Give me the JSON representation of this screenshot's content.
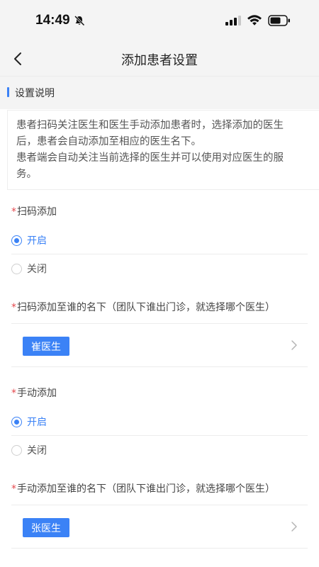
{
  "status_bar": {
    "time": "14:49"
  },
  "navbar": {
    "title": "添加患者设置"
  },
  "section": {
    "title": "设置说明"
  },
  "description": {
    "line1": "患者扫码关注医生和医生手动添加患者时，选择添加的医生",
    "line2": "后，患者会自动添加至相应的医生名下。",
    "line3": "患者端会自动关注当前选择的医生并可以使用对应医生的服",
    "line4": "务。"
  },
  "scan_add": {
    "required_mark": "*",
    "label": "扫码添加",
    "options": [
      {
        "label": "开启",
        "checked": true
      },
      {
        "label": "关闭",
        "checked": false
      }
    ]
  },
  "scan_add_target": {
    "required_mark": "*",
    "label": "扫码添加至谁的名下（团队下谁出门诊，就选择哪个医生）",
    "selected_doctor": "崔医生"
  },
  "manual_add": {
    "required_mark": "*",
    "label": "手动添加",
    "options": [
      {
        "label": "开启",
        "checked": true
      },
      {
        "label": "关闭",
        "checked": false
      }
    ]
  },
  "manual_add_target": {
    "required_mark": "*",
    "label": "手动添加至谁的名下（团队下谁出门诊，就选择哪个医生）",
    "selected_doctor": "张医生"
  },
  "colors": {
    "accent": "#3b82f6",
    "required": "#e5484d"
  },
  "icons": [
    "bell-off-icon",
    "cellular-signal-icon",
    "wifi-icon",
    "battery-icon",
    "back-arrow-icon",
    "chevron-right-icon"
  ]
}
